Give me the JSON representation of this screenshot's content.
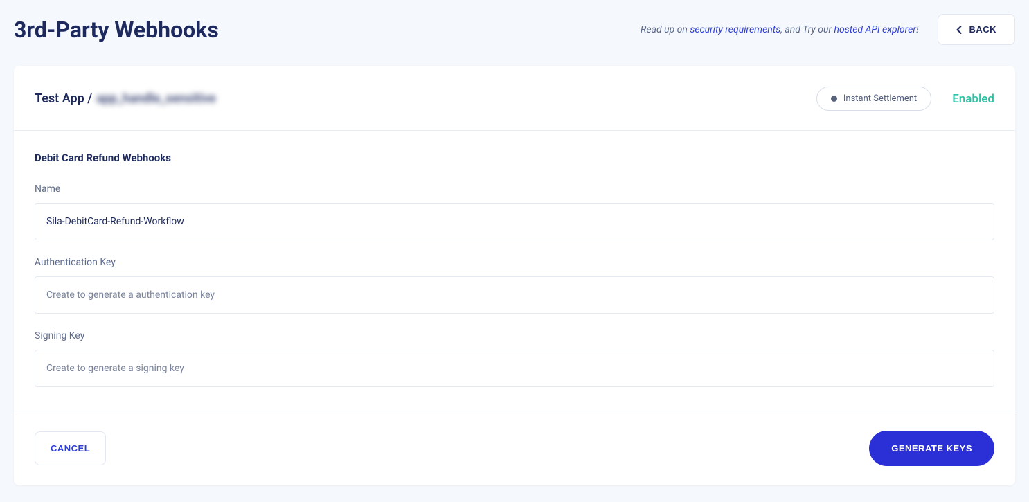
{
  "page": {
    "title": "3rd-Party Webhooks"
  },
  "header": {
    "prefix_text": "Read up on ",
    "link1_text": "security requirements",
    "mid_text": ", and Try our ",
    "link2_text": "hosted API explorer",
    "suffix_text": "!",
    "back_label": "BACK"
  },
  "card": {
    "breadcrumb_app": "Test App / ",
    "breadcrumb_detail": "app_handle_sensitive",
    "badge": {
      "label": "Instant Settlement"
    },
    "status": "Enabled",
    "section_title": "Debit Card Refund Webhooks",
    "fields": {
      "name": {
        "label": "Name",
        "value": "Sila-DebitCard-Refund-Workflow"
      },
      "auth_key": {
        "label": "Authentication Key",
        "placeholder": "Create to generate a authentication key",
        "value": ""
      },
      "signing_key": {
        "label": "Signing Key",
        "placeholder": "Create to generate a signing key",
        "value": ""
      }
    },
    "footer": {
      "cancel_label": "CANCEL",
      "generate_label": "GENERATE KEYS"
    }
  }
}
